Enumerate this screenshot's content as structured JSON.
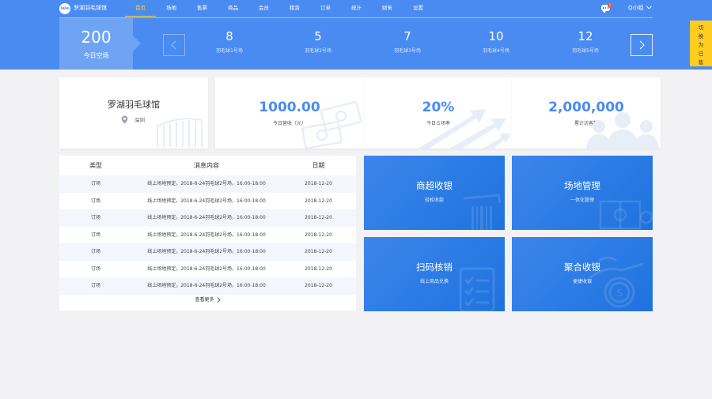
{
  "app": {
    "logo_text": "lele",
    "brand": "罗湖羽毛球馆",
    "nav": [
      "首页",
      "场地",
      "售票",
      "商品",
      "会员",
      "租赁",
      "订单",
      "统计",
      "财务",
      "设置"
    ],
    "active_nav_index": 0,
    "message_badge": "1",
    "user": "Q小姐"
  },
  "courts": {
    "today_free": {
      "value": "200",
      "label": "今日空场"
    },
    "items": [
      {
        "value": "8",
        "label": "羽毛球1号场"
      },
      {
        "value": "5",
        "label": "羽毛球2号场"
      },
      {
        "value": "7",
        "label": "羽毛球3号场"
      },
      {
        "value": "10",
        "label": "羽毛球4号场"
      },
      {
        "value": "12",
        "label": "羽毛球5号场"
      }
    ],
    "switch_label": "切换为已售"
  },
  "cards": {
    "venue": {
      "name": "罗湖羽毛球馆",
      "location": "深圳"
    },
    "revenue": {
      "value": "1000.00",
      "label": "今日营收（元）"
    },
    "occupancy": {
      "value": "20%",
      "label": "今日占场率"
    },
    "visitors": {
      "value": "2,000,000",
      "label": "累计访客数"
    }
  },
  "messages": {
    "headers": [
      "类型",
      "消息内容",
      "日期"
    ],
    "rows": [
      [
        "订场",
        "线上场地预定，2018-6-24羽毛球2号场，16:00-18:00",
        "2018-12-20"
      ],
      [
        "订场",
        "线上场地预定，2018-6-24羽毛球2号场，16:00-18:00",
        "2018-12-20"
      ],
      [
        "订场",
        "线上场地预定，2018-6-24羽毛球2号场，16:00-18:00",
        "2018-12-20"
      ],
      [
        "订场",
        "线上场地预定，2018-6-24羽毛球2号场，16:00-18:00",
        "2018-12-20"
      ],
      [
        "订场",
        "线上场地预定，2018-6-24羽毛球2号场，16:00-18:00",
        "2018-12-20"
      ],
      [
        "订场",
        "线上场地预定，2018-6-24羽毛球2号场，16:00-18:00",
        "2018-12-20"
      ],
      [
        "订场",
        "线上场地预定，2018-6-24羽毛球2号场，16:00-18:00",
        "2018-12-20"
      ]
    ],
    "more": "查看更多"
  },
  "tiles": [
    {
      "title": "商超收银",
      "subtitle": "轻松收款",
      "icon": "barcode-scan-icon"
    },
    {
      "title": "场地管理",
      "subtitle": "一体化管理",
      "icon": "court-icon"
    },
    {
      "title": "扫码核销",
      "subtitle": "线上商品兑换",
      "icon": "checklist-icon"
    },
    {
      "title": "聚合收银",
      "subtitle": "便捷收银",
      "icon": "coin-hand-icon"
    }
  ],
  "colors": {
    "primary": "#4a8bf2",
    "accent": "#ffd21f",
    "switch": "#ffcd1f",
    "tile": "#2a7ce6",
    "badge": "#f5503c"
  }
}
